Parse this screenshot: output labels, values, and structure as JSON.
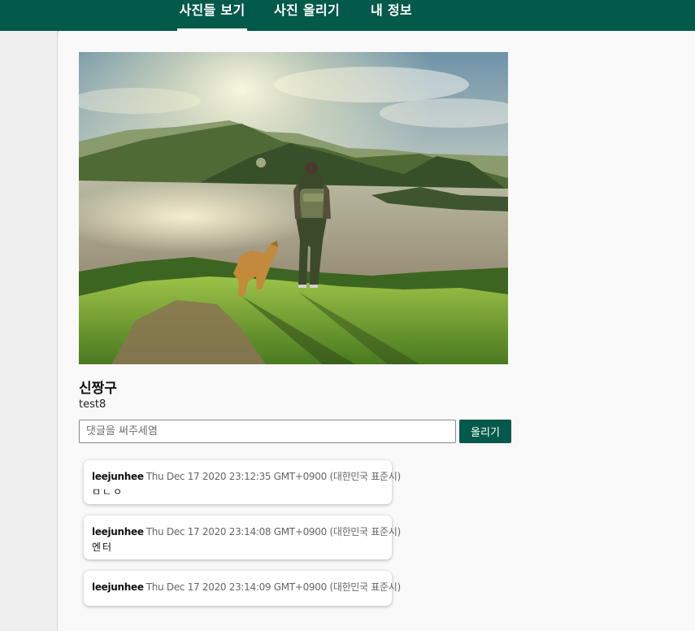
{
  "nav": {
    "tabs": [
      {
        "label": "사진들 보기",
        "active": true
      },
      {
        "label": "사진 올리기",
        "active": false
      },
      {
        "label": "내 정보",
        "active": false
      }
    ],
    "accent_color": "#03594a"
  },
  "post": {
    "title": "신짱구",
    "author": "test8"
  },
  "comment_form": {
    "placeholder": "댓글을 써주세염",
    "value": "",
    "submit_label": "올리기"
  },
  "comments": [
    {
      "user": "leejunhee",
      "date": "Thu Dec 17 2020 23:12:35 GMT+0900 (대한민국 표준시)",
      "text": "ㅁㄴㅇ"
    },
    {
      "user": "leejunhee",
      "date": "Thu Dec 17 2020 23:14:08 GMT+0900 (대한민국 표준시)",
      "text": "엔터"
    },
    {
      "user": "leejunhee",
      "date": "Thu Dec 17 2020 23:14:09 GMT+0900 (대한민국 표준시)",
      "text": ""
    }
  ]
}
